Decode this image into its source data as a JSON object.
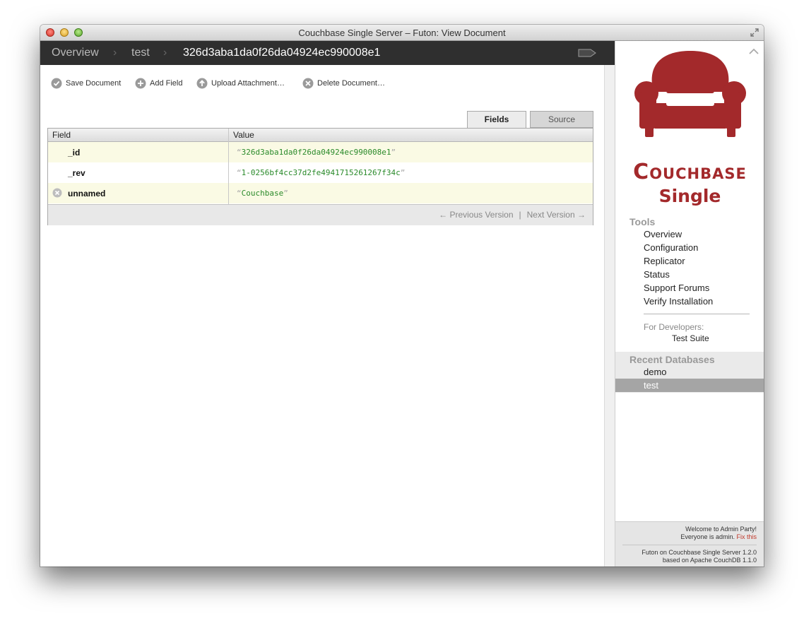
{
  "window": {
    "title": "Couchbase Single Server – Futon: View Document"
  },
  "breadcrumb": {
    "overview": "Overview",
    "database": "test",
    "document": "326d3aba1da0f26da04924ec990008e1",
    "separator": "›"
  },
  "toolbar": {
    "save": "Save Document",
    "add_field": "Add Field",
    "upload": "Upload Attachment…",
    "delete": "Delete Document…"
  },
  "tabs": {
    "fields": "Fields",
    "source": "Source",
    "active": "Fields"
  },
  "grid": {
    "headers": {
      "field": "Field",
      "value": "Value"
    },
    "rows": [
      {
        "field": "_id",
        "value": "326d3aba1da0f26da04924ec990008e1"
      },
      {
        "field": "_rev",
        "value": "1-0256bf4cc37d2fe4941715261267f34c"
      },
      {
        "field": "unnamed",
        "value": "Couchbase",
        "deletable": true
      }
    ],
    "quote_open": "“",
    "quote_close": "”"
  },
  "pager": {
    "previous": "← Previous Version",
    "separator": "|",
    "next": "Next Version →"
  },
  "sidebar": {
    "brand_name": "Couchbase",
    "brand_edition": "Single",
    "brand_color": "#a3292b",
    "tools_title": "Tools",
    "tools": [
      "Overview",
      "Configuration",
      "Replicator",
      "Status",
      "Support Forums",
      "Verify Installation"
    ],
    "developers_label": "For Developers:",
    "developers_items": [
      "Test Suite"
    ],
    "recent_title": "Recent Databases",
    "recent": [
      "demo",
      "test"
    ],
    "recent_active": "test",
    "footer": {
      "welcome": "Welcome to Admin Party!",
      "everyone": "Everyone is admin.",
      "fix": "Fix this",
      "version1": "Futon on Couchbase Single Server 1.2.0",
      "version2": "based on Apache CouchDB 1.1.0"
    }
  },
  "icons": {
    "save": "check-circle-icon",
    "add": "plus-circle-icon",
    "upload": "up-arrow-circle-icon",
    "delete": "x-circle-icon",
    "tag": "tag-icon",
    "fullscreen": "fullscreen-arrows-icon"
  }
}
